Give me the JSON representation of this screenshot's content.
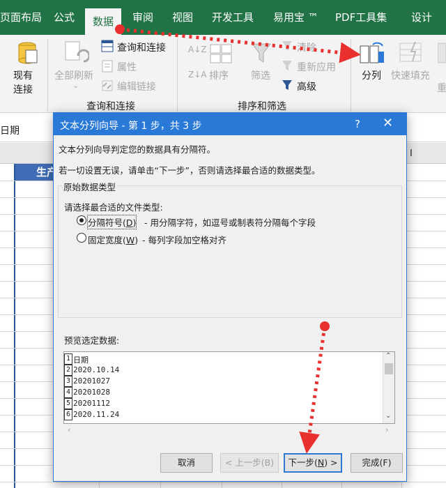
{
  "ribbon_tabs": [
    {
      "label": "页面布局"
    },
    {
      "label": "公式"
    },
    {
      "label": "数据"
    },
    {
      "label": "审阅"
    },
    {
      "label": "视图"
    },
    {
      "label": "开发工具"
    },
    {
      "label": "易用宝 ™"
    },
    {
      "label": "PDF工具集"
    },
    {
      "label": "设计"
    }
  ],
  "ribbon": {
    "existing_conn": [
      "现有",
      "连接"
    ],
    "refresh_all": "全部刷新",
    "query_conn": "查询和连接",
    "properties": "属性",
    "edit_links": "编辑链接",
    "group_query": "查询和连接",
    "sort": "排序",
    "filter": "筛选",
    "clear": "清除",
    "reapply": "重新应用",
    "advanced": "高级",
    "group_sort": "排序和筛选",
    "text_to_columns": "分列",
    "flash_fill": "快速填充",
    "more_partial": "重"
  },
  "sheet": {
    "name_box_text": "日期",
    "col_i": "I",
    "header_partial": "生产"
  },
  "dialog": {
    "title": "文本分列向导 - 第 1 步，共 3 步",
    "help": "?",
    "close": "✕",
    "line1": "文本分列向导判定您的数据具有分隔符。",
    "line2": "若一切设置无误，请单击“下一步”，否则请选择最合适的数据类型。",
    "group_title": "原始数据类型",
    "choose_prompt": "请选择最合适的文件类型:",
    "delimited_label": "分隔符号(",
    "delimited_key": "D",
    "delimited_desc": "- 用分隔字符，如逗号或制表符分隔每个字段",
    "fixed_label": "固定宽度(",
    "fixed_key": "W",
    "fixed_desc": "- 每列字段加空格对齐",
    "preview_label": "预览选定数据:",
    "preview_rows": [
      {
        "no": "1",
        "text": "日期"
      },
      {
        "no": "2",
        "text": "2020.10.14"
      },
      {
        "no": "3",
        "text": "20201027"
      },
      {
        "no": "4",
        "text": "20201028"
      },
      {
        "no": "5",
        "text": "20201112"
      },
      {
        "no": "6",
        "text": "2020.11.24"
      }
    ],
    "cancel": "取消",
    "back": "< 上一步(B)",
    "next_label": "下一步(",
    "next_key": "N",
    "next_suffix": ") >",
    "finish": "完成(F)"
  },
  "colors": {
    "ribbon_green": "#217346",
    "dialog_blue": "#2b79d6",
    "arrow_red": "#e8312f"
  }
}
